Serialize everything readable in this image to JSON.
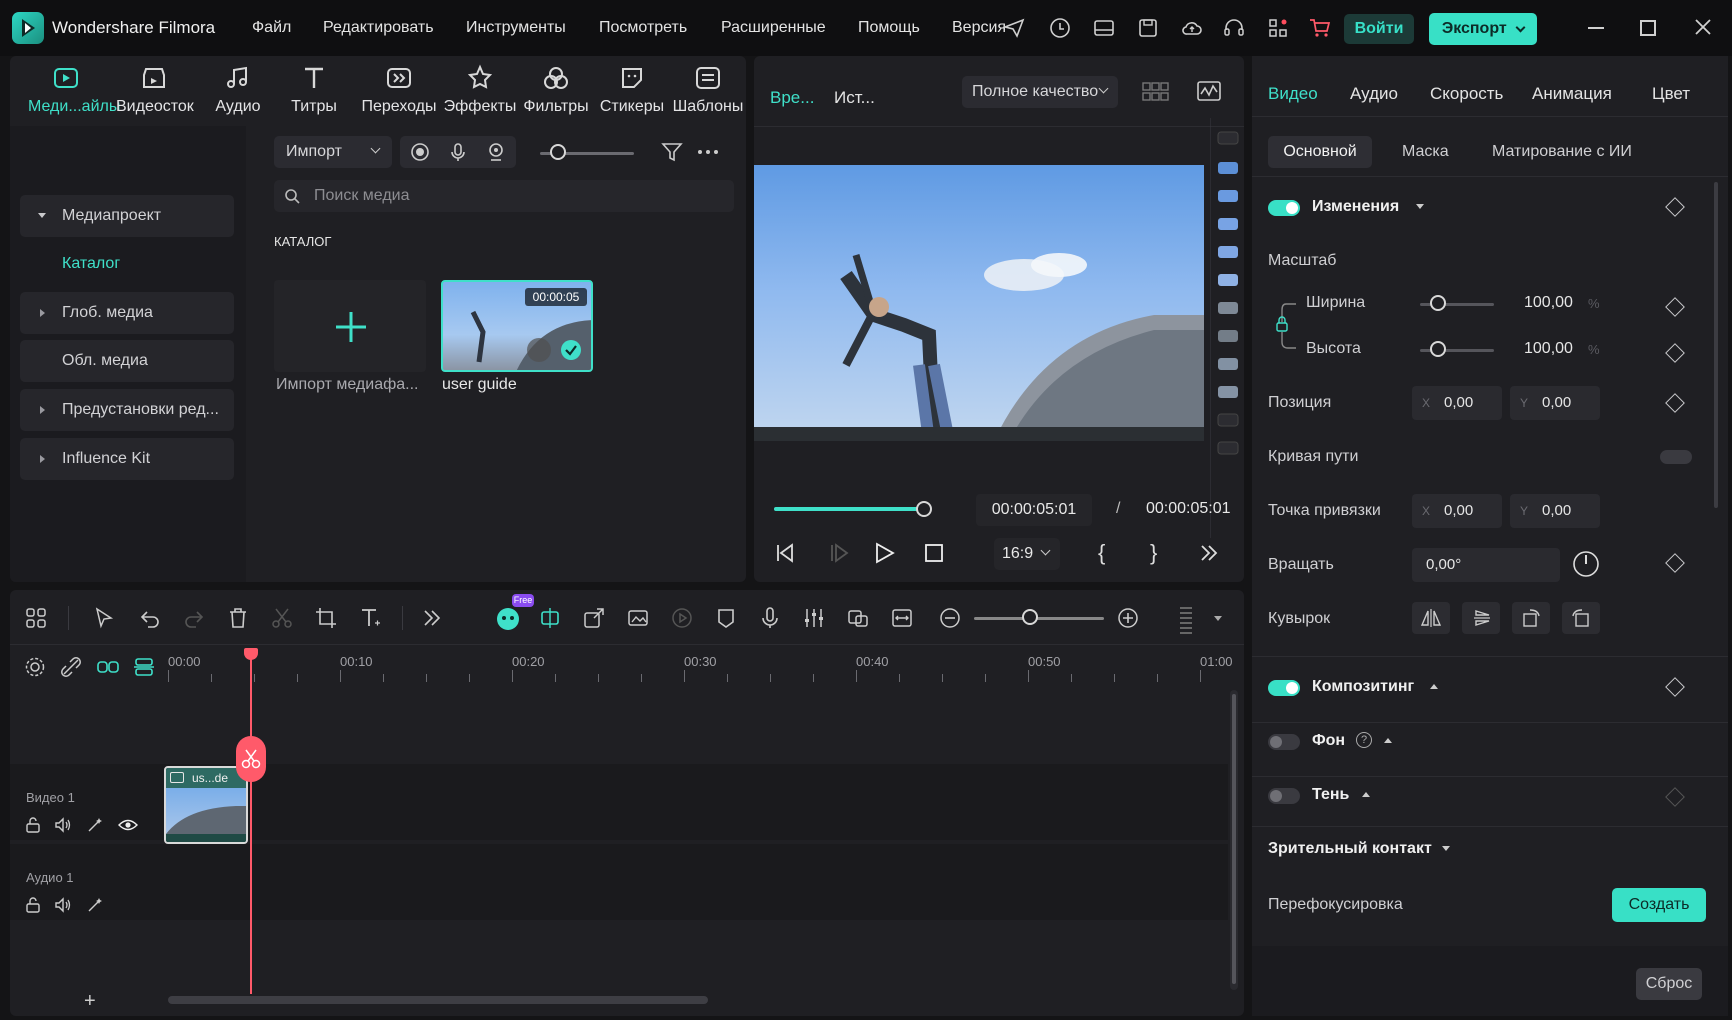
{
  "app": {
    "title": "Wondershare Filmora"
  },
  "menu": [
    "Файл",
    "Редактировать",
    "Инструменты",
    "Посмотреть",
    "Расширенные",
    "Помощь",
    "Версия"
  ],
  "header": {
    "login_label": "Войти",
    "export_label": "Экспорт"
  },
  "toolbar_tabs": [
    {
      "label": "Меди...айлы",
      "icon": "media-icon"
    },
    {
      "label": "Видеосток",
      "icon": "stock-icon"
    },
    {
      "label": "Аудио",
      "icon": "music-icon"
    },
    {
      "label": "Титры",
      "icon": "title-icon"
    },
    {
      "label": "Переходы",
      "icon": "transition-icon"
    },
    {
      "label": "Эффекты",
      "icon": "effects-icon"
    },
    {
      "label": "Фильтры",
      "icon": "filters-icon"
    },
    {
      "label": "Стикеры",
      "icon": "stickers-icon"
    },
    {
      "label": "Шаблоны",
      "icon": "templates-icon"
    }
  ],
  "sidebar": {
    "items": [
      {
        "label": "Медиапроект"
      },
      {
        "label": "Каталог"
      },
      {
        "label": "Глоб. медиа"
      },
      {
        "label": "Обл. медиа"
      },
      {
        "label": "Предустановки ред..."
      },
      {
        "label": "Influence Kit"
      }
    ]
  },
  "media": {
    "import_label": "Импорт",
    "search_placeholder": "Поиск медиа",
    "section_title": "КАТАЛОГ",
    "import_tile_label": "Импорт медиафа...",
    "clip": {
      "name": "user guide",
      "duration": "00:00:05"
    }
  },
  "preview": {
    "tab_timeline": "Вре...",
    "tab_source": "Ист...",
    "quality": "Полное качество",
    "current_time": "00:00:05:01",
    "separator": "/",
    "total_time": "00:00:05:01",
    "aspect": "16:9",
    "progress": 1.0
  },
  "properties": {
    "tabs": [
      "Видео",
      "Аудио",
      "Скорость",
      "Анимация",
      "Цвет"
    ],
    "subtabs": [
      "Основной",
      "Маска",
      "Матирование с ИИ"
    ],
    "transform_title": "Изменения",
    "scale_label": "Масштаб",
    "width_label": "Ширина",
    "width_value": "100,00",
    "height_label": "Высота",
    "height_value": "100,00",
    "percent": "%",
    "position_label": "Позиция",
    "pos_x": "0,00",
    "pos_y": "0,00",
    "axis_x": "X",
    "axis_y": "Y",
    "path_curve_label": "Кривая пути",
    "anchor_label": "Точка привязки",
    "anchor_x": "0,00",
    "anchor_y": "0,00",
    "rotate_label": "Вращать",
    "rotate_value": "0,00°",
    "flip_label": "Кувырок",
    "compositing_title": "Композитинг",
    "background_label": "Фон",
    "shadow_label": "Тень",
    "eye_contact_title": "Зрительный контакт",
    "refocus_label": "Перефокусировка",
    "create_label": "Создать",
    "reset_label": "Сброс"
  },
  "timeline": {
    "ruler": [
      "00:00",
      "00:10",
      "00:20",
      "00:30",
      "00:40",
      "00:50",
      "01:00"
    ],
    "video_track": "Видео 1",
    "audio_track": "Аудио 1",
    "clip_label": "us...de",
    "free_badge": "Free"
  }
}
